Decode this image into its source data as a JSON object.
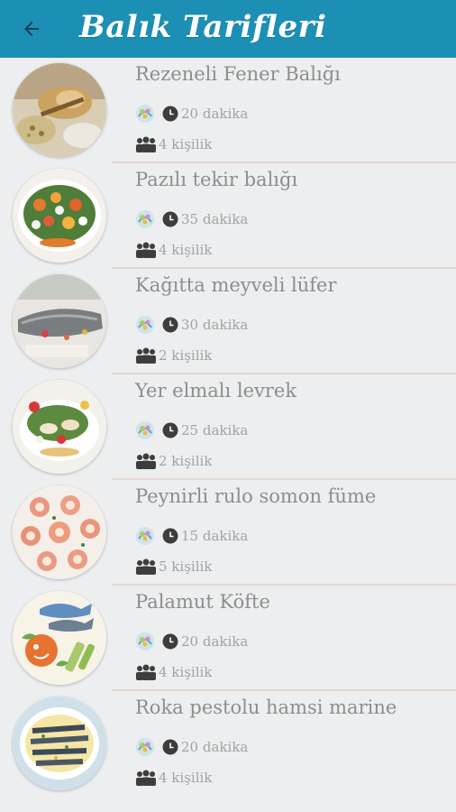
{
  "header": {
    "title": "Balık Tarifleri",
    "back_icon": "arrow-left-icon",
    "background_color": "#1c8fb4"
  },
  "recipes": [
    {
      "name": "Rezeneli Fener Balığı",
      "time": "20 dakika",
      "servings": "4 kişilik",
      "thumbnail": "roasted-fish-photo"
    },
    {
      "name": "Pazılı tekir balığı",
      "time": "35 dakika",
      "servings": "4 kişilik",
      "thumbnail": "salad-plate-photo"
    },
    {
      "name": "Kağıtta meyveli lüfer",
      "time": "30 dakika",
      "servings": "2 kişilik",
      "thumbnail": "baked-fish-photo"
    },
    {
      "name": "Yer elmalı levrek",
      "time": "25 dakika",
      "servings": "2 kişilik",
      "thumbnail": "fish-plate-photo"
    },
    {
      "name": "Peynirli rulo somon füme",
      "time": "15 dakika",
      "servings": "5 kişilik",
      "thumbnail": "salmon-rolls-photo"
    },
    {
      "name": "Palamut Köfte",
      "time": "20 dakika",
      "servings": "4 kişilik",
      "thumbnail": "fish-illustration"
    },
    {
      "name": "Roka pestolu hamsi marine",
      "time": "20 dakika",
      "servings": "4 kişilik",
      "thumbnail": "anchovy-plate-photo"
    }
  ]
}
